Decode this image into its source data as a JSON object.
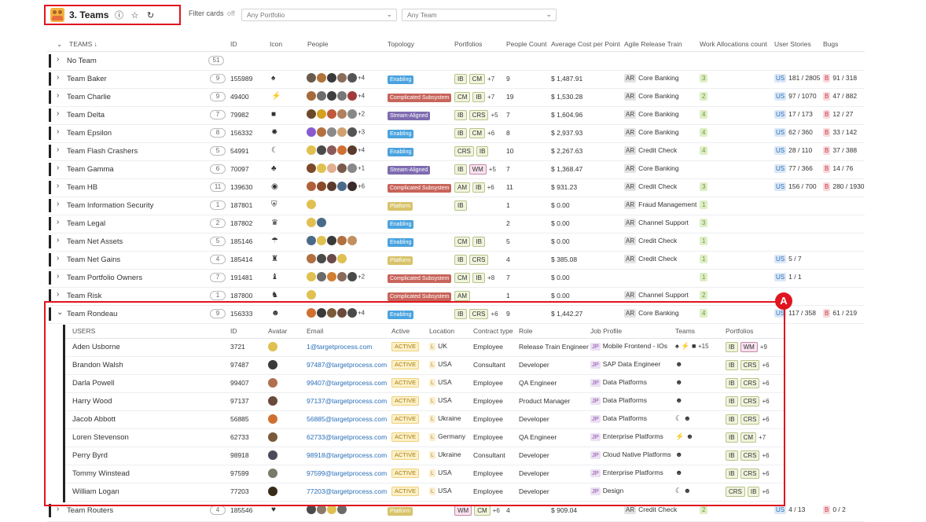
{
  "toolbar": {
    "title": "3. Teams",
    "filter_label": "Filter cards",
    "filter_state": "off",
    "portfolio_select": "Any Portfolio",
    "team_select": "Any Team"
  },
  "columns": [
    "TEAMS",
    "ID",
    "Icon",
    "People",
    "Topology",
    "Portfolios",
    "People Count",
    "Average Cost per Point",
    "Agile Release Train",
    "Work Allocations count",
    "User Stories",
    "Bugs"
  ],
  "teams": [
    {
      "name": "No Team",
      "count": "51",
      "id": "",
      "icon": "",
      "people": [],
      "more": "",
      "topology": "",
      "topo_color": "",
      "portfolios": [],
      "pmore": "",
      "pc": "",
      "cost": "",
      "art": "",
      "wa": "",
      "us": "",
      "bugs": ""
    },
    {
      "name": "Team Baker",
      "count": "9",
      "id": "155989",
      "icon": "♠",
      "people": [
        "#6a5b4f",
        "#b0733a",
        "#3a3a3a",
        "#8a6d5a",
        "#555"
      ],
      "more": "+4",
      "topology": "Enabling",
      "topo_color": "#4aa3df",
      "portfolios": [
        "IB",
        "CM"
      ],
      "pmore": "+7",
      "pc": "9",
      "cost": "$ 1,487.91",
      "art": "Core Banking",
      "wa": "3",
      "us": "181 / 2805",
      "bugs": "91 / 318"
    },
    {
      "name": "Team Charlie",
      "count": "9",
      "id": "49400",
      "icon": "⚡",
      "people": [
        "#a66a3a",
        "#6d6d6d",
        "#3f3f3f",
        "#777",
        "#a13a3a"
      ],
      "more": "+4",
      "topology": "Complicated Subsystem",
      "topo_color": "#c8645a",
      "portfolios": [
        "CM",
        "IB"
      ],
      "pmore": "+7",
      "pc": "19",
      "cost": "$ 1,530.28",
      "art": "Core Banking",
      "wa": "2",
      "us": "97 / 1070",
      "bugs": "47 / 882"
    },
    {
      "name": "Team Delta",
      "count": "7",
      "id": "79982",
      "icon": "■",
      "people": [
        "#6b4a2a",
        "#d8a020",
        "#c05a3a",
        "#b08060",
        "#888"
      ],
      "more": "+2",
      "topology": "Stream-Aligned",
      "topo_color": "#7e6bb0",
      "portfolios": [
        "IB",
        "CRS"
      ],
      "pmore": "+5",
      "pc": "7",
      "cost": "$ 1,604.96",
      "art": "Core Banking",
      "wa": "4",
      "us": "17 / 173",
      "bugs": "12 / 27"
    },
    {
      "name": "Team Epsilon",
      "count": "8",
      "id": "156332",
      "icon": "✹",
      "people": [
        "#8a5ad0",
        "#b57040",
        "#8a8a8a",
        "#d0a070",
        "#555"
      ],
      "more": "+3",
      "topology": "Enabling",
      "topo_color": "#4aa3df",
      "portfolios": [
        "IB",
        "CM"
      ],
      "pmore": "+6",
      "pc": "8",
      "cost": "$ 2,937.93",
      "art": "Core Banking",
      "wa": "4",
      "us": "62 / 360",
      "bugs": "33 / 142"
    },
    {
      "name": "Team Flash Crashers",
      "count": "5",
      "id": "54991",
      "icon": "☾",
      "people": [
        "#e0c050",
        "#4a4a4a",
        "#8a5a5a",
        "#d07030",
        "#5a3a2a"
      ],
      "more": "+4",
      "topology": "Enabling",
      "topo_color": "#4aa3df",
      "portfolios": [
        "CRS",
        "IB"
      ],
      "pmore": "",
      "pc": "10",
      "cost": "$ 2,267.63",
      "art": "Credit Check",
      "wa": "4",
      "us": "28 / 110",
      "bugs": "37 / 388"
    },
    {
      "name": "Team Gamma",
      "count": "6",
      "id": "70097",
      "icon": "♣",
      "people": [
        "#7a4a2a",
        "#e0c050",
        "#e0b090",
        "#7a5a4a",
        "#888"
      ],
      "more": "+1",
      "topology": "Stream-Aligned",
      "topo_color": "#7e6bb0",
      "portfolios": [
        "IB",
        "WM"
      ],
      "pmore": "+5",
      "pc": "7",
      "cost": "$ 1,368.47",
      "art": "Core Banking",
      "wa": "",
      "us": "77 / 366",
      "bugs": "14 / 76"
    },
    {
      "name": "Team HB",
      "count": "11",
      "id": "139630",
      "icon": "◉",
      "people": [
        "#b0603a",
        "#8a4a2a",
        "#5a3a2a",
        "#4a6a8a",
        "#3a2a2a"
      ],
      "more": "+6",
      "topology": "Complicated Subsystem",
      "topo_color": "#c8645a",
      "portfolios": [
        "AM",
        "IB"
      ],
      "pmore": "+6",
      "pc": "11",
      "cost": "$ 931.23",
      "art": "Credit Check",
      "wa": "3",
      "us": "156 / 700",
      "bugs": "280 / 1930"
    },
    {
      "name": "Team Information Security",
      "count": "1",
      "id": "187801",
      "icon": "⛨",
      "people": [
        "#e0c050"
      ],
      "more": "",
      "topology": "Platform",
      "topo_color": "#d7c36a",
      "portfolios": [
        "IB"
      ],
      "pmore": "",
      "pc": "1",
      "cost": "$ 0.00",
      "art": "Fraud Management",
      "wa": "1",
      "us": "",
      "bugs": ""
    },
    {
      "name": "Team Legal",
      "count": "2",
      "id": "187802",
      "icon": "♛",
      "people": [
        "#e0c050",
        "#4a6a8a"
      ],
      "more": "",
      "topology": "Enabling",
      "topo_color": "#4aa3df",
      "portfolios": [],
      "pmore": "",
      "pc": "2",
      "cost": "$ 0.00",
      "art": "Channel Support",
      "wa": "3",
      "us": "",
      "bugs": ""
    },
    {
      "name": "Team Net Assets",
      "count": "5",
      "id": "185146",
      "icon": "☂",
      "people": [
        "#4a6a8a",
        "#e0c050",
        "#3a3a3a",
        "#b07040",
        "#c09060"
      ],
      "more": "",
      "topology": "Enabling",
      "topo_color": "#4aa3df",
      "portfolios": [
        "CM",
        "IB"
      ],
      "pmore": "",
      "pc": "5",
      "cost": "$ 0.00",
      "art": "Credit Check",
      "wa": "1",
      "us": "",
      "bugs": ""
    },
    {
      "name": "Team Net Gains",
      "count": "4",
      "id": "185414",
      "icon": "♜",
      "people": [
        "#b07040",
        "#4a4a4a",
        "#6a4a4a",
        "#e0c050"
      ],
      "more": "",
      "topology": "Platform",
      "topo_color": "#d7c36a",
      "portfolios": [
        "IB",
        "CRS"
      ],
      "pmore": "",
      "pc": "4",
      "cost": "$ 385.08",
      "art": "Credit Check",
      "wa": "1",
      "us": "5 / 7",
      "bugs": ""
    },
    {
      "name": "Team Portfolio Owners",
      "count": "7",
      "id": "191481",
      "icon": "♝",
      "people": [
        "#e0c050",
        "#6a6a6a",
        "#d08030",
        "#8a6a5a",
        "#4a4a4a"
      ],
      "more": "+2",
      "topology": "Complicated Subsystem",
      "topo_color": "#c8645a",
      "portfolios": [
        "CM",
        "IB"
      ],
      "pmore": "+8",
      "pc": "7",
      "cost": "$ 0.00",
      "art": "",
      "wa": "1",
      "us": "1 / 1",
      "bugs": ""
    },
    {
      "name": "Team Risk",
      "count": "1",
      "id": "187800",
      "icon": "♞",
      "people": [
        "#e0c050"
      ],
      "more": "",
      "topology": "Complicated Subsystem",
      "topo_color": "#c8645a",
      "portfolios": [
        "AM"
      ],
      "pmore": "",
      "pc": "1",
      "cost": "$ 0.00",
      "art": "Channel Support",
      "wa": "2",
      "us": "",
      "bugs": ""
    },
    {
      "name": "Team Rondeau",
      "count": "9",
      "id": "156333",
      "icon": "☻",
      "people": [
        "#d07030",
        "#3a3a3a",
        "#7a5a3a",
        "#6a4a3a",
        "#4a4a4a"
      ],
      "more": "+4",
      "topology": "Enabling",
      "topo_color": "#4aa3df",
      "portfolios": [
        "IB",
        "CRS"
      ],
      "pmore": "+6",
      "pc": "9",
      "cost": "$ 1,442.27",
      "art": "Core Banking",
      "wa": "4",
      "us": "117 / 358",
      "bugs": "61 / 219"
    },
    {
      "name": "Team Routers",
      "count": "4",
      "id": "185546",
      "icon": "♥",
      "people": [
        "#4a4a4a",
        "#8a7a6a",
        "#e0c050",
        "#6a6a6a"
      ],
      "more": "",
      "topology": "Platform",
      "topo_color": "#d7c36a",
      "portfolios": [
        "WM",
        "CM"
      ],
      "pmore": "+6",
      "pc": "4",
      "cost": "$ 909.04",
      "art": "Credit Check",
      "wa": "2",
      "us": "4 / 13",
      "bugs": "0 / 2"
    }
  ],
  "users_columns": [
    "USERS",
    "ID",
    "Avatar",
    "Email",
    "Active",
    "Location",
    "Contract type",
    "Role",
    "Job Profile",
    "Teams",
    "Portfolios"
  ],
  "users": [
    {
      "name": "Aden Usborne",
      "id": "3721",
      "avatar": "#e0c050",
      "email": "1@targetprocess.com",
      "active": "ACTIVE",
      "loc": "UK",
      "contract": "Employee",
      "role": "Release Train Engineer",
      "job": "Mobile Frontend - IOs",
      "teams": "♠ ⚡ ■",
      "tmore": "+15",
      "portfolios": [
        "IB",
        "WM"
      ],
      "pmore": "+9"
    },
    {
      "name": "Brandon Walsh",
      "id": "97487",
      "avatar": "#3a3a3a",
      "email": "97487@targetprocess.com",
      "active": "ACTIVE",
      "loc": "USA",
      "contract": "Consultant",
      "role": "Developer",
      "job": "SAP Data Engineer",
      "teams": "☻",
      "tmore": "",
      "portfolios": [
        "IB",
        "CRS"
      ],
      "pmore": "+6"
    },
    {
      "name": "Darla Powell",
      "id": "99407",
      "avatar": "#b07050",
      "email": "99407@targetprocess.com",
      "active": "ACTIVE",
      "loc": "USA",
      "contract": "Employee",
      "role": "QA Engineer",
      "job": "Data Platforms",
      "teams": "☻",
      "tmore": "",
      "portfolios": [
        "IB",
        "CRS"
      ],
      "pmore": "+6"
    },
    {
      "name": "Harry Wood",
      "id": "97137",
      "avatar": "#6a4a3a",
      "email": "97137@targetprocess.com",
      "active": "ACTIVE",
      "loc": "USA",
      "contract": "Employee",
      "role": "Product Manager",
      "job": "Data Platforms",
      "teams": "☻",
      "tmore": "",
      "portfolios": [
        "IB",
        "CRS"
      ],
      "pmore": "+6"
    },
    {
      "name": "Jacob Abbott",
      "id": "56885",
      "avatar": "#d07030",
      "email": "56885@targetprocess.com",
      "active": "ACTIVE",
      "loc": "Ukraine",
      "contract": "Employee",
      "role": "Developer",
      "job": "Data Platforms",
      "teams": "☾ ☻",
      "tmore": "",
      "portfolios": [
        "IB",
        "CRS"
      ],
      "pmore": "+6"
    },
    {
      "name": "Loren Stevenson",
      "id": "62733",
      "avatar": "#7a5a3a",
      "email": "62733@targetprocess.com",
      "active": "ACTIVE",
      "loc": "Germany",
      "contract": "Employee",
      "role": "QA Engineer",
      "job": "Enterprise Platforms",
      "teams": "⚡ ☻",
      "tmore": "",
      "portfolios": [
        "IB",
        "CM"
      ],
      "pmore": "+7"
    },
    {
      "name": "Perry Byrd",
      "id": "98918",
      "avatar": "#4a4a5a",
      "email": "98918@targetprocess.com",
      "active": "ACTIVE",
      "loc": "Ukraine",
      "contract": "Consultant",
      "role": "Developer",
      "job": "Cloud Native Platforms",
      "teams": "☻",
      "tmore": "",
      "portfolios": [
        "IB",
        "CRS"
      ],
      "pmore": "+6"
    },
    {
      "name": "Tommy Winstead",
      "id": "97599",
      "avatar": "#7a7a6a",
      "email": "97599@targetprocess.com",
      "active": "ACTIVE",
      "loc": "USA",
      "contract": "Employee",
      "role": "Developer",
      "job": "Enterprise Platforms",
      "teams": "☻",
      "tmore": "",
      "portfolios": [
        "IB",
        "CRS"
      ],
      "pmore": "+6"
    },
    {
      "name": "William Logan",
      "id": "77203",
      "avatar": "#3a2a1a",
      "email": "77203@targetprocess.com",
      "active": "ACTIVE",
      "loc": "USA",
      "contract": "Employee",
      "role": "Developer",
      "job": "Design",
      "teams": "☾ ☻",
      "tmore": "",
      "portfolios": [
        "CRS",
        "IB"
      ],
      "pmore": "+6"
    }
  ],
  "annotation": {
    "label": "A"
  },
  "labels": {
    "ar": "AR",
    "us": "US",
    "b": "B",
    "loc": "L",
    "jp": "JP"
  }
}
